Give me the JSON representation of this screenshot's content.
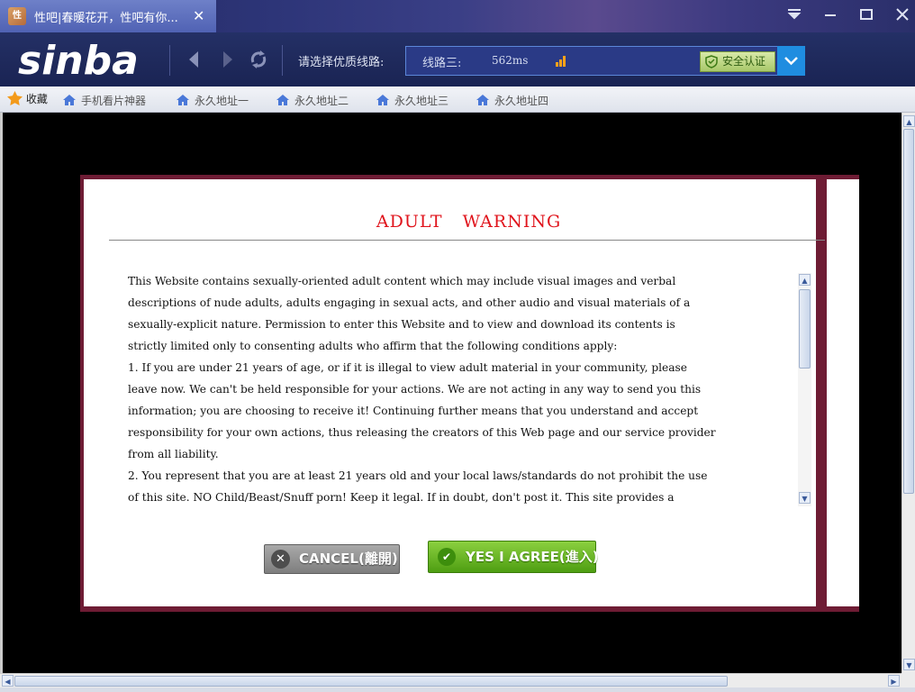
{
  "browser": {
    "tab_title": "性吧|春暖花开，性吧有你...",
    "tab_close": "✕",
    "window_controls": [
      "menu-icon",
      "minimize-icon",
      "maximize-icon",
      "close-icon"
    ]
  },
  "toolbar": {
    "logo_text": "sinba",
    "route_label": "请选择优质线路:",
    "route_name": "线路三:",
    "route_latency": "562ms",
    "secure_label": "安全认证"
  },
  "bookmarks": {
    "favorites_label": "收藏",
    "items": [
      "手机看片神器",
      "永久地址一",
      "永久地址二",
      "永久地址三",
      "永久地址四"
    ]
  },
  "dialog": {
    "title_part1": "ADULT",
    "title_part2": "WARNING",
    "terms_lines": [
      "This Website contains sexually-oriented adult content which may include visual images and verbal",
      "descriptions of nude adults, adults engaging in sexual acts, and other audio and visual materials of a",
      "sexually-explicit nature. Permission to enter this Website and to view and download its contents is",
      "strictly limited only to consenting adults who affirm that the following conditions apply:",
      "1. If you are under 21 years of age, or if it is illegal to view adult material in your community, please",
      "leave now. We can't be held responsible for your actions. We are not acting in any way to send you this",
      "information; you are choosing to receive it! Continuing further means that you understand and accept",
      "responsibility for your own actions, thus releasing the creators of this Web page and our service provider",
      "from all liability.",
      "2. You represent that you are at least 21 years old and your local laws/standards do not prohibit the use",
      "of this site. NO Child/Beast/Snuff porn! Keep it legal. If in doubt, don't post it. This site provides a"
    ],
    "cancel_label": "CANCEL(離開)",
    "agree_label": "YES I AGREE(進入)"
  },
  "colors": {
    "title_red": "#e0141c",
    "dialog_border": "#6e1c34",
    "agree_green": "#5aab1c",
    "cancel_gray": "#8a8a8a",
    "accent_blue": "#1f8de0"
  }
}
